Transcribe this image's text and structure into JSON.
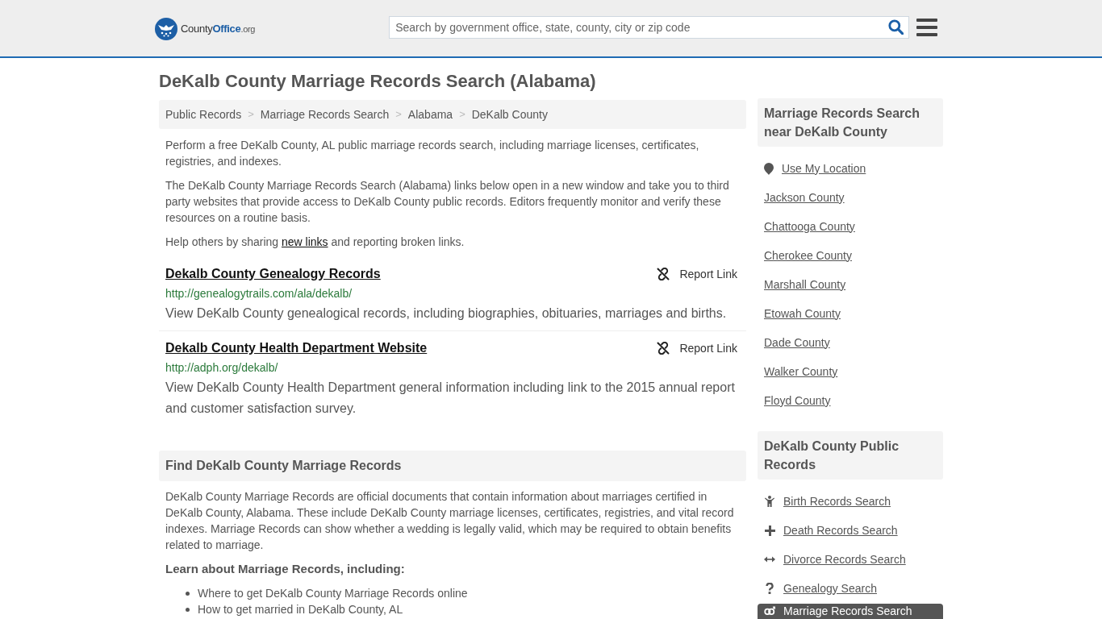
{
  "header": {
    "logo": {
      "name": "County",
      "highlight": "Office",
      "suffix": ".org"
    },
    "search": {
      "placeholder": "Search by government office, state, county, city or zip code"
    }
  },
  "page": {
    "title": "DeKalb County Marriage Records Search (Alabama)",
    "breadcrumb": {
      "separator": ">",
      "items": [
        "Public Records",
        "Marriage Records Search",
        "Alabama",
        "DeKalb County"
      ]
    },
    "intro": [
      "Perform a free DeKalb County, AL public marriage records search, including marriage licenses, certificates, registries, and indexes.",
      "The DeKalb County Marriage Records Search (Alabama) links below open in a new window and take you to third party websites that provide access to DeKalb County public records. Editors frequently monitor and verify these resources on a routine basis."
    ],
    "help": {
      "before": "Help others by sharing ",
      "link": "new links",
      "after": " and reporting broken links."
    },
    "links": [
      {
        "title": "Dekalb County Genealogy Records",
        "url": "http://genealogytrails.com/ala/dekalb/",
        "description": "View DeKalb County genealogical records, including biographies, obituaries, marriages and births.",
        "report": "Report Link"
      },
      {
        "title": "Dekalb County Health Department Website",
        "url": "http://adph.org/dekalb/",
        "description": "View DeKalb County Health Department general information including link to the 2015 annual report and customer satisfaction survey.",
        "report": "Report Link"
      }
    ],
    "find": {
      "heading": "Find DeKalb County Marriage Records",
      "text": "DeKalb County Marriage Records are official documents that contain information about marriages certified in DeKalb County, Alabama. These include DeKalb County marriage licenses, certificates, registries, and vital record indexes. Marriage Records can show whether a wedding is legally valid, which may be required to obtain benefits related to marriage.",
      "subheading": "Learn about Marriage Records, including:",
      "items": [
        "Where to get DeKalb County Marriage Records online",
        "How to get married in DeKalb County, AL"
      ]
    }
  },
  "sidebar": {
    "nearby": {
      "heading": "Marriage Records Search near DeKalb County",
      "location": "Use My Location",
      "items": [
        "Jackson County",
        "Chattooga County",
        "Cherokee County",
        "Marshall County",
        "Etowah County",
        "Dade County",
        "Walker County",
        "Floyd County"
      ]
    },
    "public_records": {
      "heading": "DeKalb County Public Records",
      "items": [
        {
          "label": "Birth Records Search",
          "kind": "birth",
          "selected": false
        },
        {
          "label": "Death Records Search",
          "kind": "death",
          "selected": false
        },
        {
          "label": "Divorce Records Search",
          "kind": "divorce",
          "selected": false
        },
        {
          "label": "Genealogy Search",
          "kind": "genealogy",
          "selected": false
        },
        {
          "label": "Marriage Records Search",
          "kind": "marriage",
          "selected": true
        }
      ]
    }
  }
}
